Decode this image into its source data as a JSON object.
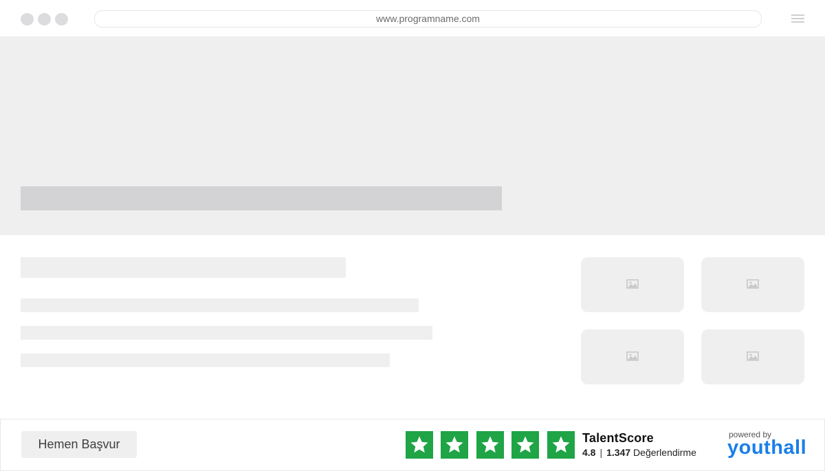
{
  "browser": {
    "url": "www.programname.com"
  },
  "footer": {
    "apply_label": "Hemen Başvur",
    "talentscore": {
      "title": "TalentScore",
      "rating": "4.8",
      "separator": "|",
      "review_count": "1.347",
      "review_label": "Değerlendirme",
      "stars": 5,
      "star_color": "#1fa446"
    },
    "powered_by": "powered by",
    "brand": "youthall",
    "brand_color": "#1a7ee8"
  }
}
